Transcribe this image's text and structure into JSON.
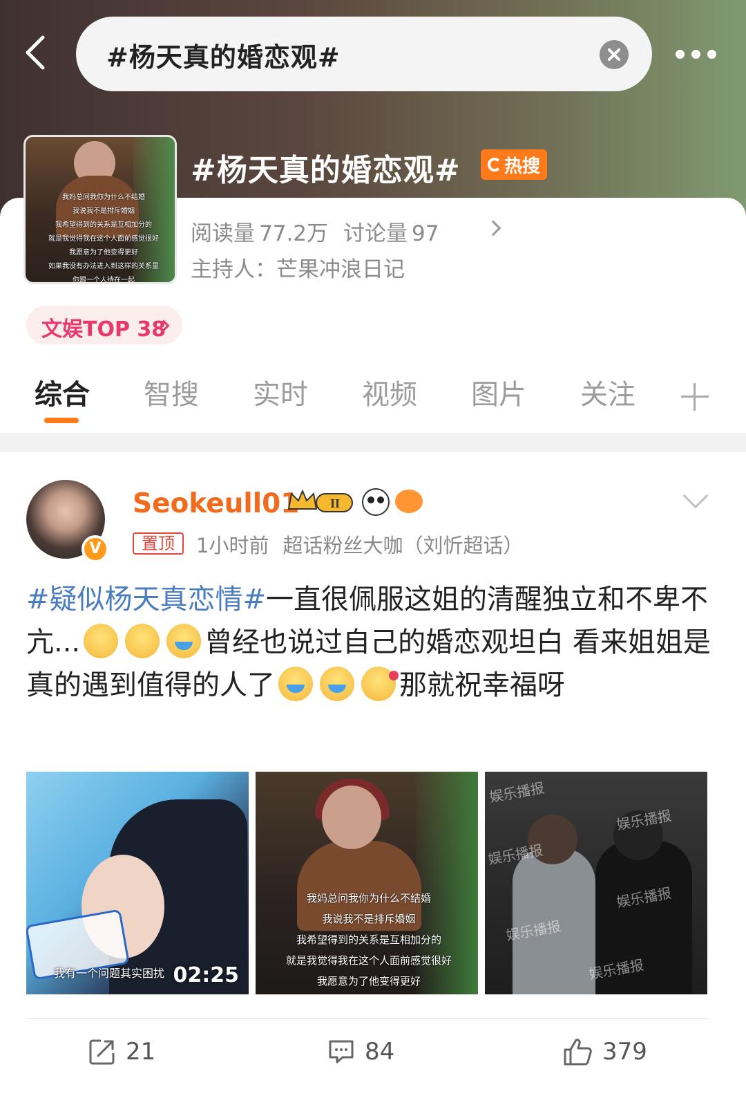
{
  "header": {
    "search_text": "#杨天真的婚恋观#"
  },
  "topic": {
    "title": "#杨天真的婚恋观#",
    "hot_badge": "热搜",
    "reads_label": "阅读量",
    "reads_value": "77.2万",
    "discuss_label": "讨论量",
    "discuss_value": "97",
    "host_label": "主持人：",
    "host_name": "芒果冲浪日记",
    "rank": "文娱TOP 38",
    "cover_lines": [
      "我妈总问我你为什么不结婚",
      "我说我不是排斥婚姻",
      "我希望得到的关系是互相加分的",
      "就是我觉得我在这个人面前感觉很好",
      "我愿意为了他变得更好",
      "如果我没有办法进入到这样的关系里",
      "你跟一个人待在一起"
    ]
  },
  "tabs": [
    "综合",
    "智搜",
    "实时",
    "视频",
    "图片",
    "关注"
  ],
  "post": {
    "username": "Seokeull01",
    "pinned": "置顶",
    "time": "1小时前",
    "source": "超话粉丝大咖（刘忻超话）",
    "tag": "#疑似杨天真恋情#",
    "text1": "一直很佩服这姐的清醒独立和不卑不亢...",
    "text2": "曾经也说过自己的婚恋观坦白 看来姐姐是真的遇到值得的人了",
    "text3": "那就祝幸福呀",
    "thumb1_caption": "我有一个问题其实困扰",
    "thumb1_duration": "02:25",
    "thumb2_lines": [
      "我妈总问我你为什么不结婚",
      "我说我不是排斥婚姻",
      "我希望得到的关系是互相加分的",
      "就是我觉得我在这个人面前感觉很好",
      "我愿意为了他变得更好"
    ],
    "thumb3_watermark": "娱乐播报",
    "reposts": "21",
    "comments": "84",
    "likes": "379"
  },
  "colors": {
    "accent": "#ff7a1a",
    "username": "#f26a1b",
    "tag": "#4a7cc0",
    "rank": "#e8386a"
  }
}
